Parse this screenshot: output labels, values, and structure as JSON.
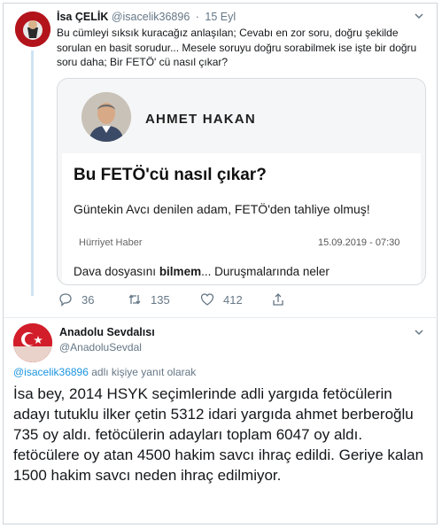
{
  "tweet1": {
    "name": "İsa ÇELİK",
    "handle": "@isacelik36896",
    "date": "15 Eyl",
    "text": "Bu cümleyi sıksık kuracağız anlaşılan; Cevabı en zor soru, doğru şekilde sorulan en basit sorudur... Mesele soruyu doğru sorabilmek ise işte bir doğru soru daha; Bir FETÖ' cü nasıl çıkar?",
    "card": {
      "author": "AHMET HAKAN",
      "title": "Bu FETÖ'cü nasıl çıkar?",
      "subtitle": "Güntekin Avcı denilen adam, FETÖ'den tahliye olmuş!",
      "source": "Hürriyet Haber",
      "datetime": "15.09.2019 - 07:30",
      "body_pre": "Dava dosyasını ",
      "body_bold": "bilmem",
      "body_post": "... Duruşmalarında neler"
    },
    "actions": {
      "replies": "36",
      "retweets": "135",
      "likes": "412"
    }
  },
  "tweet2": {
    "name": "Anadolu Sevdalısı",
    "handle": "@AnadoluSevdal",
    "reply_handle": "@isacelik36896",
    "reply_suffix": "adlı kişiye yanıt olarak",
    "text": "İsa bey, 2014 HSYK seçimlerinde adli yargıda fetöcülerin adayı tutuklu ilker çetin 5312 idari yargıda ahmet berberoğlu 735 oy aldı. fetöcülerin adayları toplam 6047 oy aldı. fetöcülere oy atan 4500 hakim savcı ihraç edildi. Geriye kalan 1500 hakim savcı neden ihraç edilmiyor."
  },
  "icons": {
    "chevron": "chevron-down-icon",
    "reply": "reply-icon",
    "retweet": "retweet-icon",
    "like": "heart-icon",
    "share": "share-icon"
  },
  "colors": {
    "accent": "#1b95e0",
    "muted": "#657786",
    "thread_line": "#cfe3f3"
  }
}
